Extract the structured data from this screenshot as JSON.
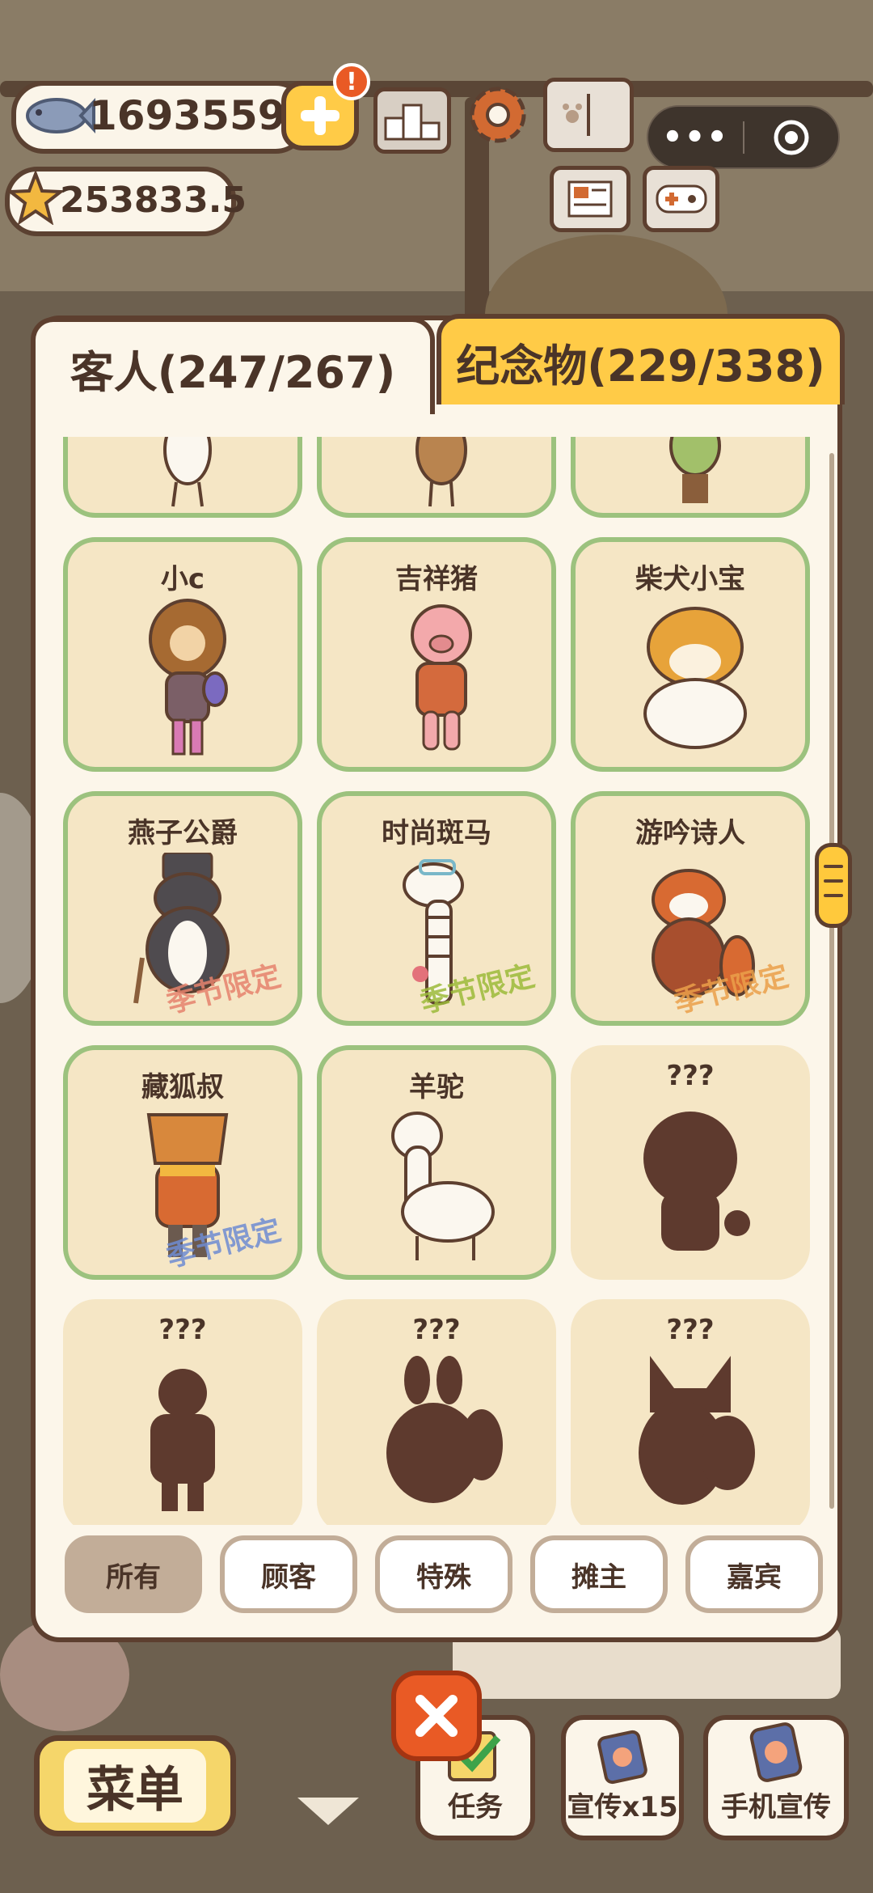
{
  "hud": {
    "fish_count": "1693559",
    "star_count": "253833.5"
  },
  "tabs": [
    {
      "label": "客人(247/267)",
      "active": true
    },
    {
      "label": "纪念物(229/338)",
      "active": false
    }
  ],
  "seasonal_stamp": "季节限定",
  "characters": [
    {
      "name": "小c",
      "owned": true
    },
    {
      "name": "吉祥猪",
      "owned": true
    },
    {
      "name": "柴犬小宝",
      "owned": true
    },
    {
      "name": "燕子公爵",
      "owned": true,
      "stamp_color": "#e6836d"
    },
    {
      "name": "时尚斑马",
      "owned": true,
      "stamp_color": "#9cbb3a"
    },
    {
      "name": "游吟诗人",
      "owned": true,
      "stamp_color": "#eba04a"
    },
    {
      "name": "藏狐叔",
      "owned": true,
      "stamp_color": "#6f8cd2"
    },
    {
      "name": "羊驼",
      "owned": true
    },
    {
      "name": "???",
      "owned": false
    },
    {
      "name": "???",
      "owned": false
    },
    {
      "name": "???",
      "owned": false
    },
    {
      "name": "???",
      "owned": false
    }
  ],
  "filters": [
    {
      "label": "所有",
      "active": true
    },
    {
      "label": "顾客",
      "active": false
    },
    {
      "label": "特殊",
      "active": false
    },
    {
      "label": "摊主",
      "active": false
    },
    {
      "label": "嘉宾",
      "active": false
    }
  ],
  "bottom": {
    "menu_label": "菜单",
    "task_label": "任务",
    "promote_label": "宣传x15",
    "phone_promote_label": "手机宣传"
  },
  "colors": {
    "owned_border": "#9cc27e",
    "card_bg": "#f5e6c5",
    "tab_inactive": "#ffcb47",
    "silhouette": "#5e3a2e"
  }
}
